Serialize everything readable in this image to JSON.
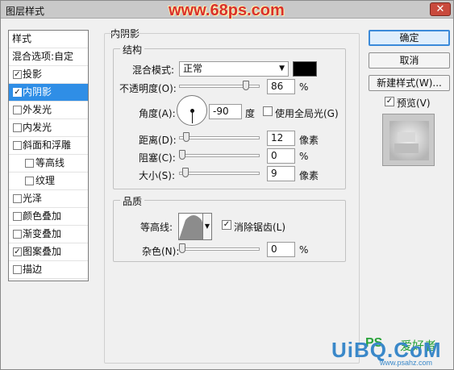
{
  "window": {
    "title": "图层样式",
    "close_label": "✕",
    "watermark_text": "www.68ps.com"
  },
  "styles_list": {
    "header": "样式",
    "blend_options": "混合选项:自定",
    "items": [
      {
        "label": "投影",
        "checked": true,
        "selected": false,
        "indent": false
      },
      {
        "label": "内阴影",
        "checked": true,
        "selected": true,
        "indent": false
      },
      {
        "label": "外发光",
        "checked": false,
        "selected": false,
        "indent": false
      },
      {
        "label": "内发光",
        "checked": false,
        "selected": false,
        "indent": false
      },
      {
        "label": "斜面和浮雕",
        "checked": false,
        "selected": false,
        "indent": false
      },
      {
        "label": "等高线",
        "checked": false,
        "selected": false,
        "indent": true
      },
      {
        "label": "纹理",
        "checked": false,
        "selected": false,
        "indent": true
      },
      {
        "label": "光泽",
        "checked": false,
        "selected": false,
        "indent": false
      },
      {
        "label": "颜色叠加",
        "checked": false,
        "selected": false,
        "indent": false
      },
      {
        "label": "渐变叠加",
        "checked": false,
        "selected": false,
        "indent": false
      },
      {
        "label": "图案叠加",
        "checked": true,
        "selected": false,
        "indent": false
      },
      {
        "label": "描边",
        "checked": false,
        "selected": false,
        "indent": false
      }
    ]
  },
  "inner_shadow": {
    "section_title": "内阴影",
    "structure": {
      "title": "结构",
      "blend_mode_label": "混合模式:",
      "blend_mode_value": "正常",
      "color": "#000000",
      "opacity_label": "不透明度(O):",
      "opacity_value": "86",
      "opacity_unit": "%",
      "opacity_fraction": 0.86,
      "angle_label": "角度(A):",
      "angle_value": "-90",
      "angle_unit": "度",
      "global_light_label": "使用全局光(G)",
      "global_light_checked": false,
      "distance_label": "距离(D):",
      "distance_value": "12",
      "distance_unit": "像素",
      "distance_fraction": 0.05,
      "choke_label": "阻塞(C):",
      "choke_value": "0",
      "choke_unit": "%",
      "choke_fraction": 0,
      "size_label": "大小(S):",
      "size_value": "9",
      "size_unit": "像素",
      "size_fraction": 0.04
    },
    "quality": {
      "title": "品质",
      "contour_label": "等高线:",
      "antialias_label": "消除锯齿(L)",
      "antialias_checked": true,
      "noise_label": "杂色(N):",
      "noise_value": "0",
      "noise_unit": "%",
      "noise_fraction": 0
    }
  },
  "buttons": {
    "ok": "确定",
    "cancel": "取消",
    "new_style": "新建样式(W)..."
  },
  "preview": {
    "label": "预览(V)",
    "checked": true
  },
  "brand": {
    "main": "UiBQ.CoM",
    "ps": "PS",
    "cn": "爱好者",
    "small": "www.psahz.com"
  }
}
